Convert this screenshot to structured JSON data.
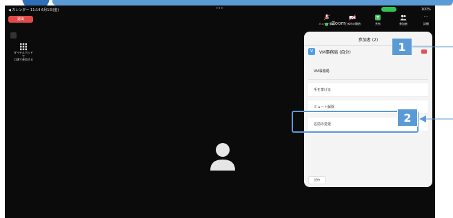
{
  "status_bar": {
    "left_text": "◀ カレンダー  11:14  6月1日(金)",
    "right_text": "100%"
  },
  "toolbar": {
    "leave_label": "退出",
    "meeting_title": "Zoom",
    "buttons": [
      {
        "label": "ミュート解除",
        "icon": "microphone-icon"
      },
      {
        "label": "ビデオの開始",
        "icon": "video-camera-icon"
      },
      {
        "label": "共有",
        "icon": "share-icon"
      },
      {
        "label": "参加者",
        "icon": "participants-icon"
      },
      {
        "label": "詳細",
        "icon": "more-icon"
      }
    ],
    "participants_count_badge": "2"
  },
  "left_overlay": {
    "dialpad_label": "ダイヤルパッド\nで\n口頭で参加する"
  },
  "panel": {
    "title": "参加者 (2)",
    "participant_name": "VM事務局 (自分)",
    "participant_initial": "V",
    "menu_header": "VM事務局",
    "menu_items": [
      "手を挙げる",
      "ミュート解除",
      "名前の変更"
    ],
    "invite_label": "招待"
  },
  "callouts": {
    "step_1": "1",
    "step_2": "2"
  },
  "colors": {
    "callout_blue": "#5b9bd5",
    "leave_red": "#e24a4a",
    "zoom_green": "#39c25a",
    "avatar_blue": "#4f9fe0"
  }
}
